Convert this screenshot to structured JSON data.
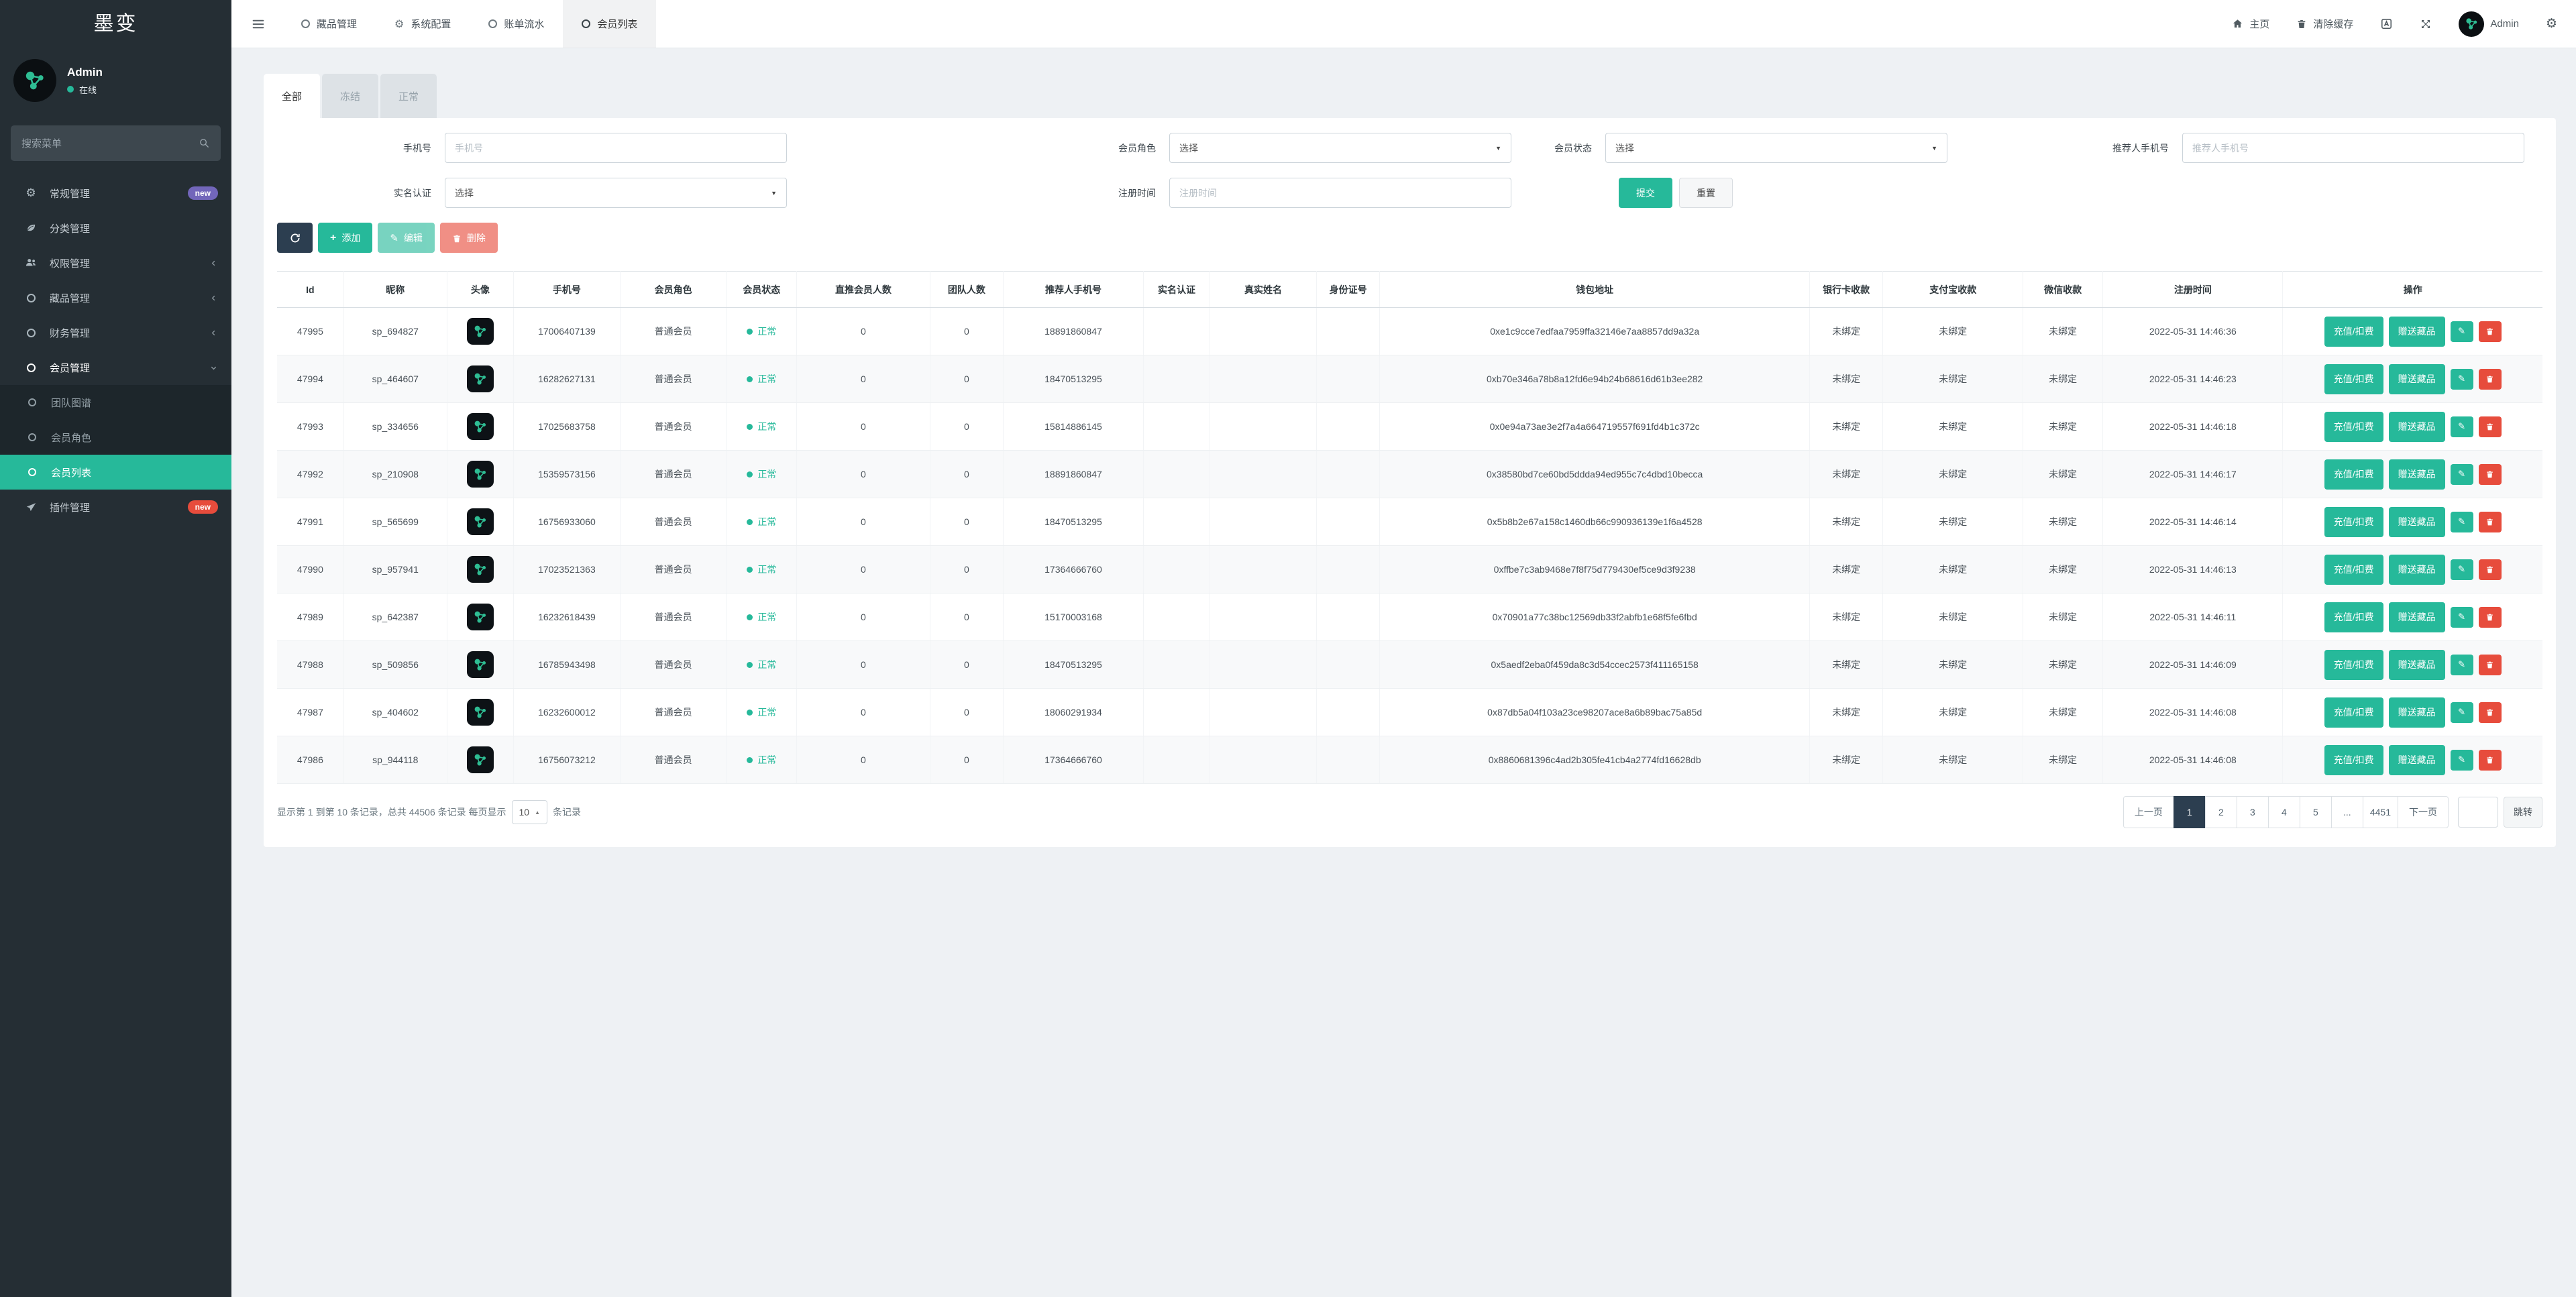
{
  "app": {
    "logo_text": "墨变"
  },
  "user": {
    "name": "Admin",
    "status": "在线"
  },
  "colors": {
    "accent_green": "#26b99a",
    "danger_red": "#e74c3c",
    "dark_navy": "#2c3e50",
    "badge_purple": "#7266ba",
    "sidebar_bg": "#252e34"
  },
  "sidebar": {
    "search_placeholder": "搜索菜单",
    "items": [
      {
        "label": "常规管理",
        "badge": "new"
      },
      {
        "label": "分类管理"
      },
      {
        "label": "权限管理"
      },
      {
        "label": "藏品管理"
      },
      {
        "label": "财务管理"
      },
      {
        "label": "会员管理"
      },
      {
        "label": "团队图谱"
      },
      {
        "label": "会员角色"
      },
      {
        "label": "会员列表"
      },
      {
        "label": "插件管理",
        "badge": "new"
      }
    ]
  },
  "topnav": {
    "tabs": [
      {
        "label": "藏品管理"
      },
      {
        "label": "系统配置"
      },
      {
        "label": "账单流水"
      },
      {
        "label": "会员列表"
      }
    ],
    "right": {
      "home": "主页",
      "clear_cache": "清除缓存",
      "username": "Admin"
    }
  },
  "filter_tabs": [
    {
      "label": "全部"
    },
    {
      "label": "冻结"
    },
    {
      "label": "正常"
    }
  ],
  "filters": {
    "phone_label": "手机号",
    "phone_placeholder": "手机号",
    "role_label": "会员角色",
    "role_value": "选择",
    "status_label": "会员状态",
    "status_value": "选择",
    "referrer_label": "推荐人手机号",
    "referrer_placeholder": "推荐人手机号",
    "auth_label": "实名认证",
    "auth_value": "选择",
    "regtime_label": "注册时间",
    "regtime_placeholder": "注册时间",
    "submit_label": "提交",
    "reset_label": "重置"
  },
  "toolbar": {
    "add_label": "添加",
    "edit_label": "编辑",
    "delete_label": "删除"
  },
  "table": {
    "columns": [
      "Id",
      "昵称",
      "头像",
      "手机号",
      "会员角色",
      "会员状态",
      "直推会员人数",
      "团队人数",
      "推荐人手机号",
      "实名认证",
      "真实姓名",
      "身份证号",
      "钱包地址",
      "银行卡收款",
      "支付宝收款",
      "微信收款",
      "注册时间",
      "操作"
    ],
    "actions": {
      "recharge": "充值/扣费",
      "gift": "赠送藏品"
    },
    "rows": [
      {
        "id": "47995",
        "nickname": "sp_694827",
        "phone": "17006407139",
        "role": "普通会员",
        "status": "正常",
        "direct": "0",
        "team": "0",
        "referrer": "18891860847",
        "auth": "",
        "realname": "",
        "idcard": "",
        "wallet": "0xe1c9cce7edfaa7959ffa32146e7aa8857dd9a32a",
        "bank": "未绑定",
        "alipay": "未绑定",
        "wechat": "未绑定",
        "regtime": "2022-05-31 14:46:36"
      },
      {
        "id": "47994",
        "nickname": "sp_464607",
        "phone": "16282627131",
        "role": "普通会员",
        "status": "正常",
        "direct": "0",
        "team": "0",
        "referrer": "18470513295",
        "auth": "",
        "realname": "",
        "idcard": "",
        "wallet": "0xb70e346a78b8a12fd6e94b24b68616d61b3ee282",
        "bank": "未绑定",
        "alipay": "未绑定",
        "wechat": "未绑定",
        "regtime": "2022-05-31 14:46:23"
      },
      {
        "id": "47993",
        "nickname": "sp_334656",
        "phone": "17025683758",
        "role": "普通会员",
        "status": "正常",
        "direct": "0",
        "team": "0",
        "referrer": "15814886145",
        "auth": "",
        "realname": "",
        "idcard": "",
        "wallet": "0x0e94a73ae3e2f7a4a664719557f691fd4b1c372c",
        "bank": "未绑定",
        "alipay": "未绑定",
        "wechat": "未绑定",
        "regtime": "2022-05-31 14:46:18"
      },
      {
        "id": "47992",
        "nickname": "sp_210908",
        "phone": "15359573156",
        "role": "普通会员",
        "status": "正常",
        "direct": "0",
        "team": "0",
        "referrer": "18891860847",
        "auth": "",
        "realname": "",
        "idcard": "",
        "wallet": "0x38580bd7ce60bd5ddda94ed955c7c4dbd10becca",
        "bank": "未绑定",
        "alipay": "未绑定",
        "wechat": "未绑定",
        "regtime": "2022-05-31 14:46:17"
      },
      {
        "id": "47991",
        "nickname": "sp_565699",
        "phone": "16756933060",
        "role": "普通会员",
        "status": "正常",
        "direct": "0",
        "team": "0",
        "referrer": "18470513295",
        "auth": "",
        "realname": "",
        "idcard": "",
        "wallet": "0x5b8b2e67a158c1460db66c990936139e1f6a4528",
        "bank": "未绑定",
        "alipay": "未绑定",
        "wechat": "未绑定",
        "regtime": "2022-05-31 14:46:14"
      },
      {
        "id": "47990",
        "nickname": "sp_957941",
        "phone": "17023521363",
        "role": "普通会员",
        "status": "正常",
        "direct": "0",
        "team": "0",
        "referrer": "17364666760",
        "auth": "",
        "realname": "",
        "idcard": "",
        "wallet": "0xffbe7c3ab9468e7f8f75d779430ef5ce9d3f9238",
        "bank": "未绑定",
        "alipay": "未绑定",
        "wechat": "未绑定",
        "regtime": "2022-05-31 14:46:13"
      },
      {
        "id": "47989",
        "nickname": "sp_642387",
        "phone": "16232618439",
        "role": "普通会员",
        "status": "正常",
        "direct": "0",
        "team": "0",
        "referrer": "15170003168",
        "auth": "",
        "realname": "",
        "idcard": "",
        "wallet": "0x70901a77c38bc12569db33f2abfb1e68f5fe6fbd",
        "bank": "未绑定",
        "alipay": "未绑定",
        "wechat": "未绑定",
        "regtime": "2022-05-31 14:46:11"
      },
      {
        "id": "47988",
        "nickname": "sp_509856",
        "phone": "16785943498",
        "role": "普通会员",
        "status": "正常",
        "direct": "0",
        "team": "0",
        "referrer": "18470513295",
        "auth": "",
        "realname": "",
        "idcard": "",
        "wallet": "0x5aedf2eba0f459da8c3d54ccec2573f411165158",
        "bank": "未绑定",
        "alipay": "未绑定",
        "wechat": "未绑定",
        "regtime": "2022-05-31 14:46:09"
      },
      {
        "id": "47987",
        "nickname": "sp_404602",
        "phone": "16232600012",
        "role": "普通会员",
        "status": "正常",
        "direct": "0",
        "team": "0",
        "referrer": "18060291934",
        "auth": "",
        "realname": "",
        "idcard": "",
        "wallet": "0x87db5a04f103a23ce98207ace8a6b89bac75a85d",
        "bank": "未绑定",
        "alipay": "未绑定",
        "wechat": "未绑定",
        "regtime": "2022-05-31 14:46:08"
      },
      {
        "id": "47986",
        "nickname": "sp_944118",
        "phone": "16756073212",
        "role": "普通会员",
        "status": "正常",
        "direct": "0",
        "team": "0",
        "referrer": "17364666760",
        "auth": "",
        "realname": "",
        "idcard": "",
        "wallet": "0x8860681396c4ad2b305fe41cb4a2774fd16628db",
        "bank": "未绑定",
        "alipay": "未绑定",
        "wechat": "未绑定",
        "regtime": "2022-05-31 14:46:08"
      }
    ]
  },
  "footer": {
    "summary_prefix": "显示第 1 到第 10 条记录，总共 44506 条记录 每页显示",
    "page_size": "10",
    "summary_suffix": "条记录"
  },
  "pagination": {
    "items": [
      "上一页",
      "1",
      "2",
      "3",
      "4",
      "5",
      "...",
      "4451",
      "下一页"
    ],
    "active": "1",
    "jump_label": "跳转"
  }
}
